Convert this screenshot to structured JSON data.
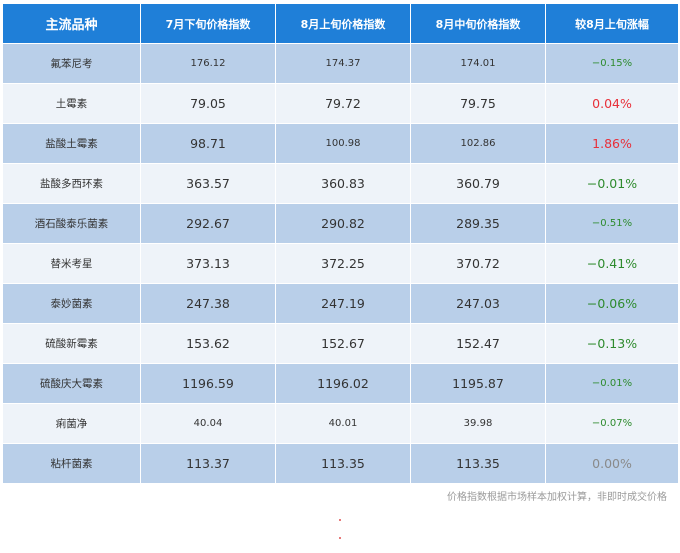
{
  "headers": [
    "主流品种",
    "7月下旬价格指数",
    "8月上旬价格指数",
    "8月中旬价格指数",
    "较8月上旬涨幅"
  ],
  "rows": [
    {
      "name": "氟苯尼考",
      "v1": "176.12",
      "v2": "174.37",
      "v3": "174.01",
      "chg": "−0.15%",
      "dir": "neg"
    },
    {
      "name": "土霉素",
      "v1": "79.05",
      "v2": "79.72",
      "v3": "79.75",
      "chg": "0.04%",
      "dir": "pos"
    },
    {
      "name": "盐酸土霉素",
      "v1": "98.71",
      "v2": "100.98",
      "v3": "102.86",
      "chg": "1.86%",
      "dir": "pos"
    },
    {
      "name": "盐酸多西环素",
      "v1": "363.57",
      "v2": "360.83",
      "v3": "360.79",
      "chg": "−0.01%",
      "dir": "neg"
    },
    {
      "name": "酒石酸泰乐菌素",
      "v1": "292.67",
      "v2": "290.82",
      "v3": "289.35",
      "chg": "−0.51%",
      "dir": "neg"
    },
    {
      "name": "替米考星",
      "v1": "373.13",
      "v2": "372.25",
      "v3": "370.72",
      "chg": "−0.41%",
      "dir": "neg"
    },
    {
      "name": "泰妙菌素",
      "v1": "247.38",
      "v2": "247.19",
      "v3": "247.03",
      "chg": "−0.06%",
      "dir": "neg"
    },
    {
      "name": "硫酸新霉素",
      "v1": "153.62",
      "v2": "152.67",
      "v3": "152.47",
      "chg": "−0.13%",
      "dir": "neg"
    },
    {
      "name": "硫酸庆大霉素",
      "v1": "1196.59",
      "v2": "1196.02",
      "v3": "1195.87",
      "chg": "−0.01%",
      "dir": "neg"
    },
    {
      "name": "痢菌净",
      "v1": "40.04",
      "v2": "40.01",
      "v3": "39.98",
      "chg": "−0.07%",
      "dir": "neg"
    },
    {
      "name": "粘杆菌素",
      "v1": "113.37",
      "v2": "113.35",
      "v3": "113.35",
      "chg": "0.00%",
      "dir": "zero"
    }
  ],
  "note": "价格指数根据市场样本加权计算，非即时成交价格",
  "colors": {
    "header": "#1f7fd8",
    "row_odd": "#b9cfe9",
    "row_even": "#eef3f9",
    "negative": "#2e8b2e",
    "positive": "#e8303a",
    "zero": "#8a8a8a"
  }
}
